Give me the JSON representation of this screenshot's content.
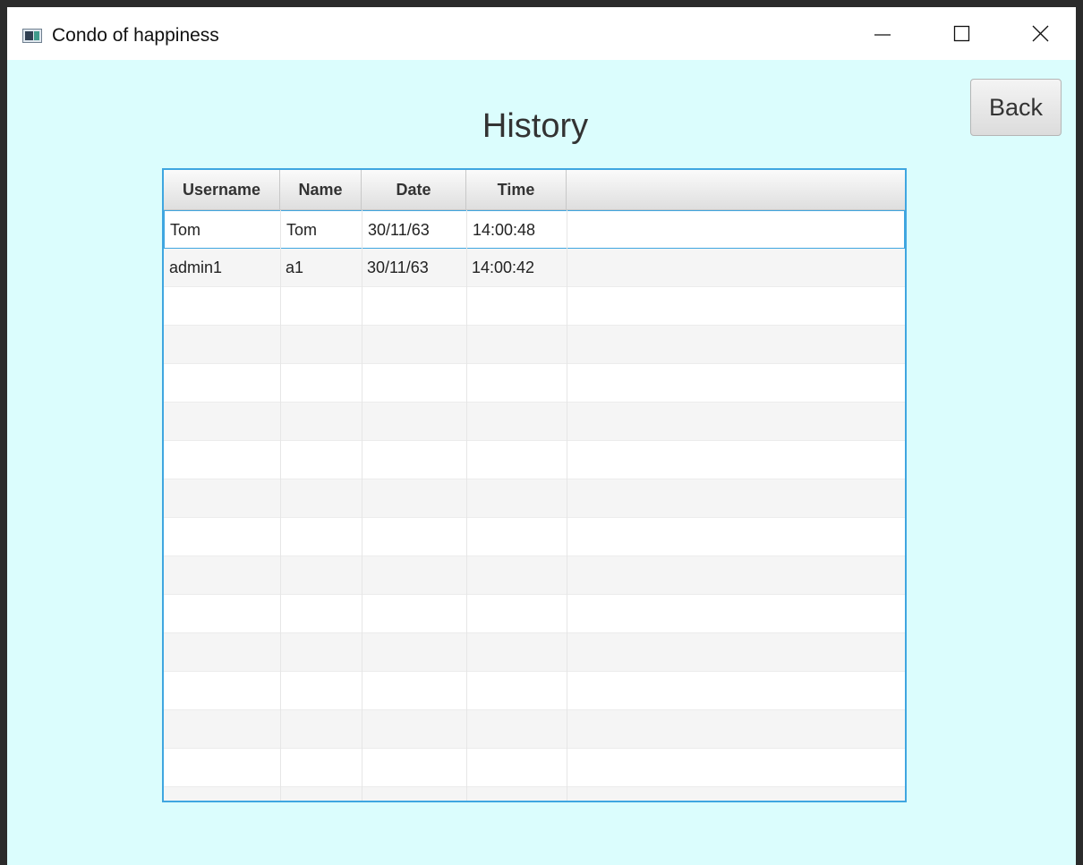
{
  "window": {
    "title": "Condo of happiness",
    "icon": "app-window-icon",
    "controls": [
      "minimize-icon",
      "maximize-icon",
      "close-icon"
    ]
  },
  "page": {
    "heading": "History",
    "back_label": "Back",
    "background_color": "#dbfdfd",
    "accent_color": "#3fa6e0"
  },
  "table": {
    "columns": [
      "Username",
      "Name",
      "Date",
      "Time"
    ],
    "rows": [
      {
        "username": "Tom",
        "name": "Tom",
        "date": "30/11/63",
        "time": "14:00:48"
      },
      {
        "username": "admin1",
        "name": "a1",
        "date": "30/11/63",
        "time": "14:00:42"
      }
    ],
    "selected_row": 0
  }
}
